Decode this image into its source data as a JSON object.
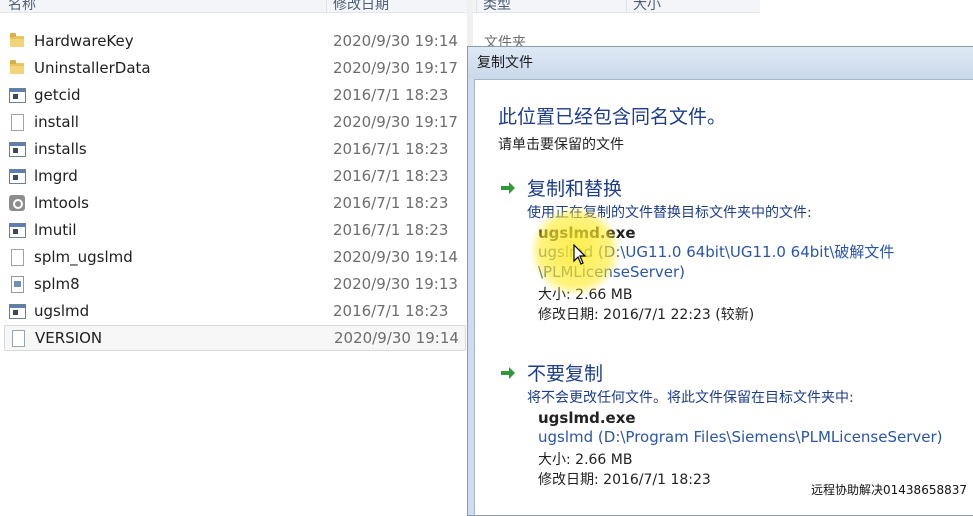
{
  "explorer": {
    "columns": {
      "name": "名称",
      "modified": "修改日期",
      "type": "类型",
      "size": "大小"
    },
    "files": [
      {
        "name": "HardwareKey",
        "date": "2020/9/30 19:14",
        "icon": "folder-icon",
        "type": "文件夹"
      },
      {
        "name": "UninstallerData",
        "date": "2020/9/30 19:17",
        "icon": "folder-icon"
      },
      {
        "name": "getcid",
        "date": "2016/7/1 18:23",
        "icon": "application-icon"
      },
      {
        "name": "install",
        "date": "2020/9/30 19:17",
        "icon": "document-icon"
      },
      {
        "name": "installs",
        "date": "2016/7/1 18:23",
        "icon": "application-icon"
      },
      {
        "name": "lmgrd",
        "date": "2016/7/1 18:23",
        "icon": "application-icon"
      },
      {
        "name": "lmtools",
        "date": "2016/7/1 18:23",
        "icon": "tool-icon"
      },
      {
        "name": "lmutil",
        "date": "2016/7/1 18:23",
        "icon": "application-icon"
      },
      {
        "name": "splm_ugslmd",
        "date": "2020/9/30 19:14",
        "icon": "document-icon"
      },
      {
        "name": "splm8",
        "date": "2020/9/30 19:13",
        "icon": "config-icon"
      },
      {
        "name": "ugslmd",
        "date": "2016/7/1 18:23",
        "icon": "application-icon"
      },
      {
        "name": "VERSION",
        "date": "2020/9/30 19:14",
        "icon": "document-icon",
        "selected": true
      }
    ]
  },
  "dialog": {
    "title": "复制文件",
    "heading": "此位置已经包含同名文件。",
    "subheading": "请单击要保留的文件",
    "options": [
      {
        "title": "复制和替换",
        "description": "使用正在复制的文件替换目标文件夹中的文件:",
        "filename": "ugslmd.exe",
        "path_line1": "ugslmd (D:\\UG11.0 64bit\\UG11.0 64bit\\破解文件",
        "path_line2": "\\PLMLicenseServer)",
        "size": "大小: 2.66 MB",
        "modified": "修改日期: 2016/7/1 22:23 (较新)"
      },
      {
        "title": "不要复制",
        "description": "将不会更改任何文件。将此文件保留在目标文件夹中:",
        "filename": "ugslmd.exe",
        "path_line1": "ugslmd (D:\\Program Files\\Siemens\\PLMLicenseServer)",
        "size": "大小: 2.66 MB",
        "modified": "修改日期: 2016/7/1 18:23"
      }
    ]
  },
  "watermark": "远程协助解决01438658837",
  "colors": {
    "dialog_accent": "#1c3d8a",
    "arrow_green": "#2e9a3a",
    "highlight": "#ffeb28"
  }
}
